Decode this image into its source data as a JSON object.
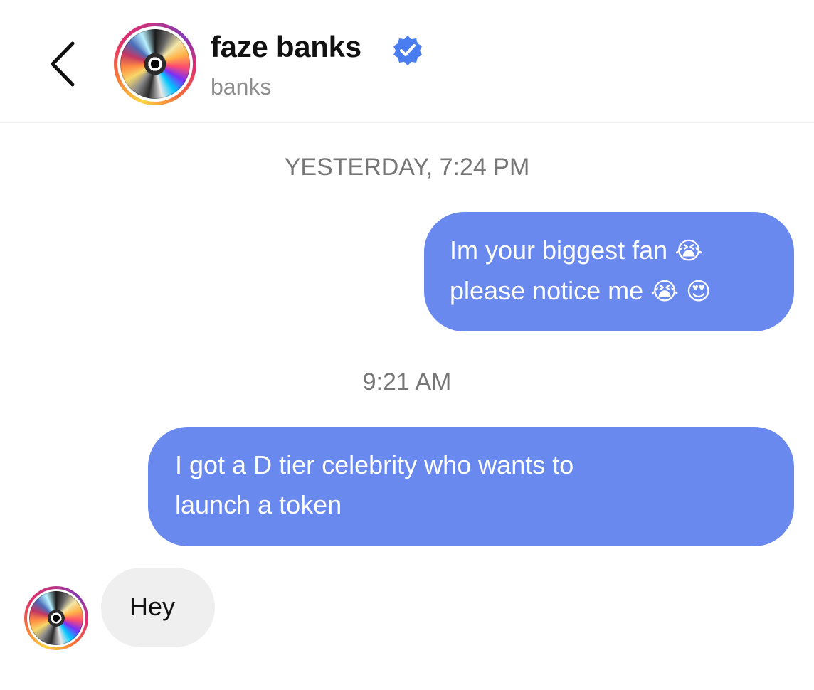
{
  "header": {
    "display_name": "faze banks",
    "username": "banks",
    "verified_color": "#4a7df0",
    "back_icon": "chevron-left-icon",
    "verified_icon": "verified-badge-icon"
  },
  "conversation": {
    "timestamp_1": "YESTERDAY, 7:24 PM",
    "message_1": {
      "line_1": "Im your biggest fan",
      "line_1_emoji": "😭",
      "line_2": "please notice me",
      "line_2_emoji_1": "😭",
      "line_2_emoji_2": "😍"
    },
    "timestamp_2": "9:21 AM",
    "message_2": {
      "line_1": "I got a D tier celebrity who wants to",
      "line_2": "launch a token"
    },
    "reply": {
      "text": "Hey"
    }
  },
  "colors": {
    "outgoing_bubble": "#6a89ee",
    "incoming_bubble": "#efefef",
    "timestamp_text": "#767676"
  }
}
